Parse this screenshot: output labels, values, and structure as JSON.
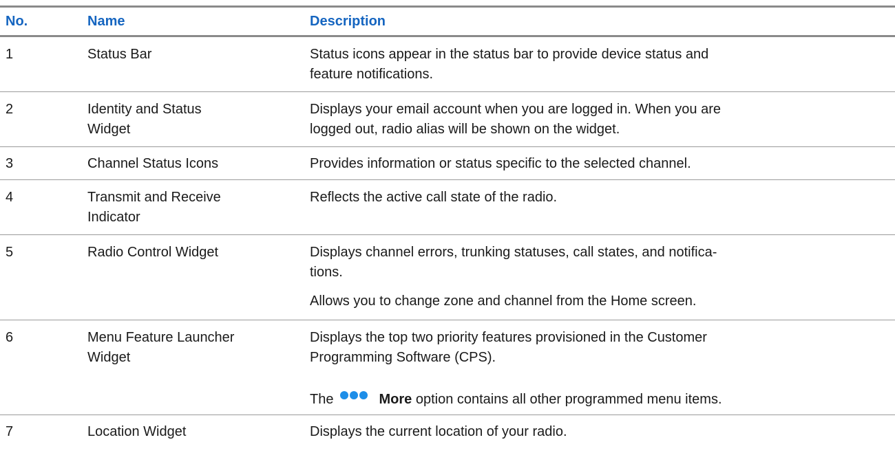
{
  "headers": {
    "no": "No.",
    "name": "Name",
    "description": "Description"
  },
  "rows": [
    {
      "no": "1",
      "name": "Status Bar",
      "desc": [
        "Status icons appear in the status bar to provide device status and",
        "feature notifications."
      ]
    },
    {
      "no": "2",
      "name_lines": [
        "Identity and Status",
        "Widget"
      ],
      "desc": [
        "Displays your email account when you are logged in. When you are",
        "logged out, radio alias will be shown on the widget."
      ]
    },
    {
      "no": "3",
      "name": "Channel Status Icons",
      "desc": [
        "Provides information or status specific to the selected channel."
      ]
    },
    {
      "no": "4",
      "name_lines": [
        "Transmit and Receive",
        "Indicator"
      ],
      "desc": [
        "Reflects the active call state of the radio."
      ]
    },
    {
      "no": "5",
      "name": "Radio Control Widget",
      "desc": [
        "Displays channel errors, trunking statuses, call states, and notifica-",
        "tions."
      ],
      "desc2": "Allows you to change zone and channel from the Home screen."
    },
    {
      "no": "6",
      "name_lines": [
        "Menu Feature Launcher",
        "Widget"
      ],
      "desc": [
        "Displays the top two priority features provisioned in the Customer",
        "Programming Software (CPS)."
      ],
      "more_prefix": "The",
      "more_icon": "more-dots-icon",
      "more_label": "More",
      "more_suffix": "option contains all other programmed menu items."
    },
    {
      "no": "7",
      "name": "Location Widget",
      "desc": [
        "Displays the current location of your radio."
      ]
    }
  ]
}
